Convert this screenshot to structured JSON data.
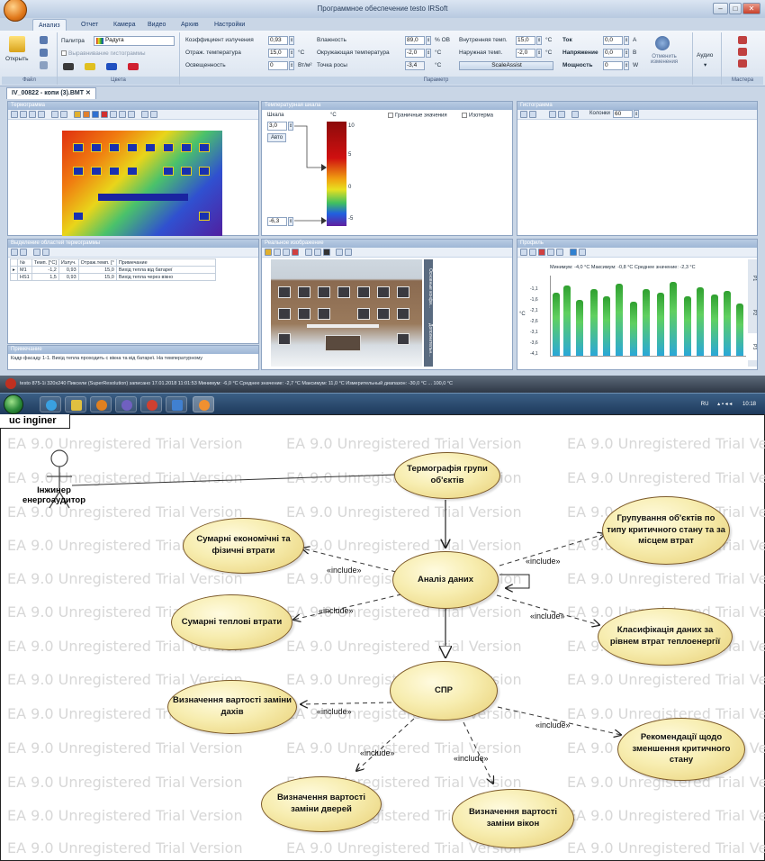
{
  "app": {
    "title": "Программное обеспечение testo IRSoft",
    "window_controls": [
      "–",
      "□",
      "✕"
    ],
    "tabs": [
      "Анализ",
      "Отчет",
      "Камера",
      "Видео",
      "Архив",
      "Настройки"
    ],
    "ribbon": {
      "open_label": "Открыть",
      "file_group": "Файл",
      "palette_label": "Палитра",
      "palette_value": "Радуга",
      "histogram_eq_label": "Выравнивание гистограммы",
      "colors_group": "Цвета",
      "param_group": "Параметр",
      "emissivity_label": "Коэффициент излучения",
      "emissivity_value": "0,93",
      "refl_temp_label": "Отраж. температура",
      "refl_temp_value": "15,0",
      "refl_temp_unit": "°C",
      "illum_label": "Освещенность",
      "illum_value": "0",
      "illum_unit": "Вт/м²",
      "humidity_label": "Влажность",
      "humidity_value": "89,0",
      "humidity_unit": "% ОВ",
      "ambient_label": "Окружающая температура",
      "ambient_value": "-2,0",
      "ambient_unit": "°C",
      "dew_label": "Точка росы",
      "dew_value": "-3,4",
      "dew_unit": "°C",
      "inner_label": "Внутренняя темп.",
      "inner_value": "15,0",
      "inner_unit": "°C",
      "outer_label": "Наружная темп.",
      "outer_value": "-2,0",
      "outer_unit": "°C",
      "scaleassist": "ScaleAssist",
      "current_label": "Ток",
      "current_value": "0,0",
      "current_unit": "A",
      "voltage_label": "Напряжение",
      "voltage_value": "0,0",
      "voltage_unit": "B",
      "power_label": "Мощность",
      "power_value": "0",
      "power_unit": "W",
      "cancel_label": "Отменить изменения",
      "audio_label": "Аудио",
      "master_group": "Мастера"
    },
    "doc_tab": "IV_00822 - копи (3).BMT",
    "thermo_panel": "Термограмма",
    "scale_panel": {
      "title": "Температурная шкала",
      "scale_label": "Шкала",
      "unit": "°C",
      "max_value": "3,0",
      "auto_label": "Авто",
      "min_value": "-6,3",
      "limits_label": "Граничные значения",
      "isotherm_label": "Изотерма",
      "ticks": [
        "10",
        "5",
        "0",
        "-5"
      ]
    },
    "hist_panel": {
      "title": "Гистограмма",
      "columns_label": "Колонки",
      "columns_value": "60"
    },
    "regions_panel": {
      "title": "Выделение областей термограммы",
      "headers": [
        "№",
        "Темп. [°C]",
        "Излуч.",
        "Отраж.темп. [°",
        "Примечание"
      ],
      "rows": [
        [
          "M1",
          "-1,2",
          "0,93",
          "15,0",
          "Вихід тепла від батареї"
        ],
        [
          "HS1",
          "1,5",
          "0,93",
          "15,0",
          "Вихід тепла через вікно"
        ]
      ]
    },
    "note_panel": {
      "title": "Примечание",
      "text": "Кадр фасаду 1-1. Вихід тепла проходить с вікна та від батареї. На температурному"
    },
    "real_panel": {
      "title": "Реальное изображение",
      "side_tabs": [
        "Основные конфи...",
        "Дополнительн..."
      ]
    },
    "profile_panel": {
      "title": "Профиль",
      "stats": "Минимум: -4,0  °C Максимум: -0,8  °C Среднее значение: -2,3  °C",
      "yticks": [
        "-1,1",
        "-1,6",
        "-2,1",
        "-2,6",
        "-3,1",
        "-3,6",
        "-4,1"
      ],
      "yaxis": "°C",
      "right_tabs": [
        "P1",
        "P2",
        "P3"
      ]
    },
    "status_text": "testo 875-1i 320x240 Пиксели (SuperResolution) записано 17.01.2018 11:01:53  Минимум: -6,0 °C  Среднее значение: -2,7 °C  Максимум: 11,0 °C  Измерительный диапазон: -30,0 °C ... 100,0 °C",
    "taskbar": {
      "lang": "RU",
      "time": "10:18"
    }
  },
  "diagram": {
    "frame_label": "uc inginer",
    "watermark_text": "EA 9.0 Unregistered Trial Version",
    "actor": "Інжинер енергоаудитор",
    "use_cases": {
      "thermography": "Термографія групи об'єктів",
      "grouping": "Групування об'єктів по типу критичного стану та за місцем втрат",
      "economic": "Сумарні економічні та фізичні втрати",
      "analysis": "Аналіз даних",
      "thermal_losses": "Сумарні теплові втрати",
      "classification": "Класифікація даних за рівнем втрат теплоенергії",
      "spr": "СПР",
      "roof_cost": "Визначення вартості заміни дахів",
      "recommendations": "Рекомендації щодо зменшення критичного стану",
      "door_cost": "Визначення вартості заміни дверей",
      "window_cost": "Визначення вартості заміни вікон"
    },
    "include_label": "«include»"
  }
}
